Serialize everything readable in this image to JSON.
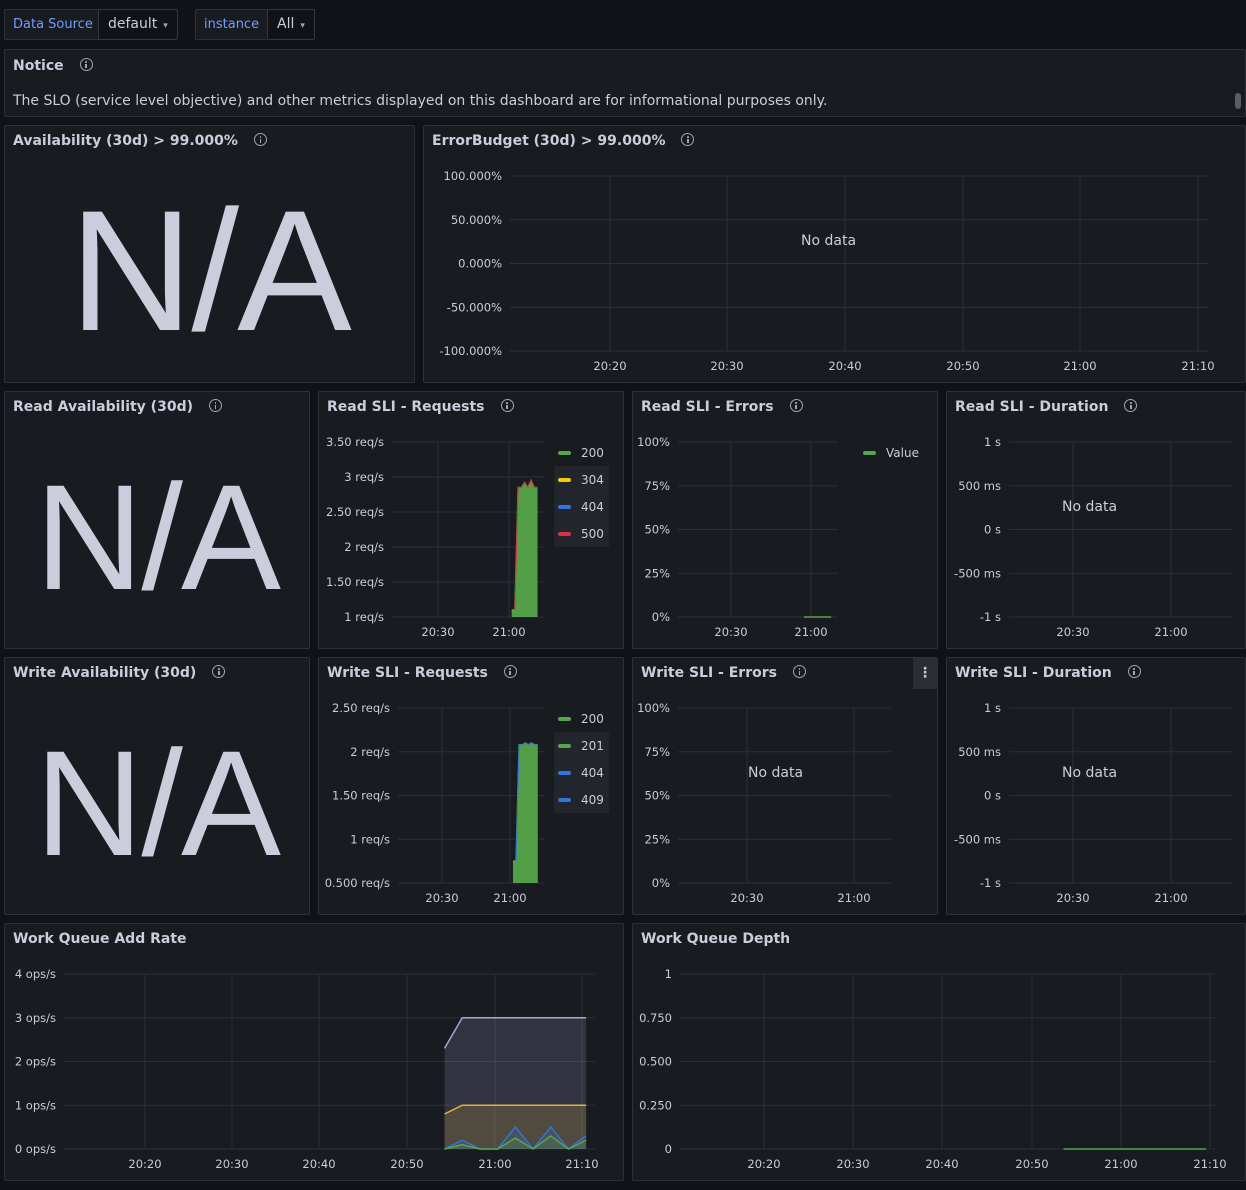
{
  "variables": {
    "datasource_label": "Data Source",
    "datasource_value": "default",
    "instance_label": "instance",
    "instance_value": "All"
  },
  "notice": {
    "title": "Notice",
    "text": "The SLO (service level objective) and other metrics displayed on this dashboard are for informational purposes only."
  },
  "panels": {
    "availability": {
      "title": "Availability (30d) > 99.000%",
      "value": "N/A"
    },
    "error_budget": {
      "title": "ErrorBudget (30d) > 99.000%",
      "no_data": "No data"
    },
    "read_availability": {
      "title": "Read Availability (30d)",
      "value": "N/A"
    },
    "read_requests": {
      "title": "Read SLI - Requests"
    },
    "read_errors": {
      "title": "Read SLI - Errors"
    },
    "read_duration": {
      "title": "Read SLI - Duration",
      "no_data": "No data"
    },
    "write_availability": {
      "title": "Write Availability (30d)",
      "value": "N/A"
    },
    "write_requests": {
      "title": "Write SLI - Requests"
    },
    "write_errors": {
      "title": "Write SLI - Errors",
      "no_data": "No data",
      "menu": "⋮"
    },
    "write_duration": {
      "title": "Write SLI - Duration",
      "no_data": "No data"
    },
    "wq_add_rate": {
      "title": "Work Queue Add Rate"
    },
    "wq_depth": {
      "title": "Work Queue Depth"
    }
  },
  "colors": {
    "green": "#56a64b",
    "yellow": "#f2cc0c",
    "blue": "#3274d9",
    "red": "#e02f44",
    "lavender": "#a9a4d8",
    "orange": "#e0b43c"
  },
  "chart_data": [
    {
      "id": "error_budget",
      "type": "line",
      "yticks": [
        "100.000%",
        "50.000%",
        "0.000%",
        "-50.000%",
        "-100.000%"
      ],
      "xticks": [
        "20:20",
        "20:30",
        "20:40",
        "20:50",
        "21:00",
        "21:10"
      ],
      "series": []
    },
    {
      "id": "read_requests",
      "type": "area",
      "yticks": [
        "3.50 req/s",
        "3 req/s",
        "2.50 req/s",
        "2 req/s",
        "1.50 req/s",
        "1 req/s"
      ],
      "ylim": [
        1,
        3.5
      ],
      "xticks": [
        "20:30",
        "21:00"
      ],
      "legend": [
        {
          "name": "200",
          "color": "#56a64b"
        },
        {
          "name": "304",
          "color": "#f2cc0c"
        },
        {
          "name": "404",
          "color": "#3274d9"
        },
        {
          "name": "500",
          "color": "#e02f44"
        }
      ],
      "series": [
        {
          "name": "200",
          "x": [
            "20:57",
            "20:58",
            "20:59",
            "21:00",
            "21:01",
            "21:02",
            "21:03",
            "21:04",
            "21:05"
          ],
          "values": [
            1.1,
            1.1,
            2.85,
            2.85,
            2.92,
            2.85,
            2.95,
            2.85,
            2.85
          ]
        }
      ]
    },
    {
      "id": "read_errors",
      "type": "line",
      "yticks": [
        "100%",
        "75%",
        "50%",
        "25%",
        "0%"
      ],
      "ylim": [
        0,
        100
      ],
      "xticks": [
        "20:30",
        "21:00"
      ],
      "legend": [
        {
          "name": "Value",
          "color": "#56a64b"
        }
      ],
      "series": [
        {
          "name": "Value",
          "x": [
            "20:57",
            "21:05"
          ],
          "values": [
            0,
            0
          ]
        }
      ]
    },
    {
      "id": "read_duration",
      "type": "line",
      "yticks": [
        "1 s",
        "500 ms",
        "0 s",
        "-500 ms",
        "-1 s"
      ],
      "xticks": [
        "20:30",
        "21:00"
      ],
      "series": []
    },
    {
      "id": "write_requests",
      "type": "area",
      "yticks": [
        "2.50 req/s",
        "2 req/s",
        "1.50 req/s",
        "1 req/s",
        "0.500 req/s"
      ],
      "ylim": [
        0.5,
        2.5
      ],
      "xticks": [
        "20:30",
        "21:00"
      ],
      "legend": [
        {
          "name": "200",
          "color": "#56a64b"
        },
        {
          "name": "201",
          "color": "#56a64b"
        },
        {
          "name": "404",
          "color": "#3274d9"
        },
        {
          "name": "409",
          "color": "#3274d9"
        }
      ],
      "series": [
        {
          "name": "201",
          "x": [
            "20:57",
            "20:58",
            "20:59",
            "21:00",
            "21:01",
            "21:02",
            "21:03",
            "21:04",
            "21:05"
          ],
          "values": [
            0.75,
            0.75,
            2.08,
            2.08,
            2.1,
            2.08,
            2.1,
            2.08,
            2.08
          ]
        }
      ]
    },
    {
      "id": "write_errors",
      "type": "line",
      "yticks": [
        "100%",
        "75%",
        "50%",
        "25%",
        "0%"
      ],
      "xticks": [
        "20:30",
        "21:00"
      ],
      "series": []
    },
    {
      "id": "write_duration",
      "type": "line",
      "yticks": [
        "1 s",
        "500 ms",
        "0 s",
        "-500 ms",
        "-1 s"
      ],
      "xticks": [
        "20:30",
        "21:00"
      ],
      "series": []
    },
    {
      "id": "wq_add_rate",
      "type": "area",
      "yticks": [
        "4 ops/s",
        "3 ops/s",
        "2 ops/s",
        "1 ops/s",
        "0 ops/s"
      ],
      "ylim": [
        0,
        4
      ],
      "xticks": [
        "20:20",
        "20:30",
        "20:40",
        "20:50",
        "21:00",
        "21:10"
      ],
      "series": [
        {
          "x": [
            "20:54",
            "20:56",
            "21:00",
            "21:05",
            "21:10"
          ],
          "values": [
            2.3,
            3.0,
            3.0,
            3.0,
            3.0
          ],
          "color": "#a9a4d8"
        },
        {
          "x": [
            "20:54",
            "20:56",
            "21:00",
            "21:05",
            "21:10"
          ],
          "values": [
            0.8,
            1.0,
            1.0,
            1.0,
            1.0
          ],
          "color": "#e0b43c"
        },
        {
          "x": [
            "20:54",
            "20:56",
            "20:58",
            "21:00",
            "21:02",
            "21:04",
            "21:06",
            "21:08",
            "21:10"
          ],
          "values": [
            0,
            0.2,
            0,
            0,
            0.5,
            0,
            0.5,
            0,
            0.3
          ],
          "color": "#3274d9"
        },
        {
          "x": [
            "20:54",
            "20:56",
            "20:58",
            "21:00",
            "21:02",
            "21:04",
            "21:06",
            "21:08",
            "21:10"
          ],
          "values": [
            0,
            0.1,
            0,
            0,
            0.25,
            0,
            0.3,
            0,
            0.2
          ],
          "color": "#56a64b"
        }
      ]
    },
    {
      "id": "wq_depth",
      "type": "line",
      "yticks": [
        "1",
        "0.750",
        "0.500",
        "0.250",
        "0"
      ],
      "ylim": [
        0,
        1
      ],
      "xticks": [
        "20:20",
        "20:30",
        "20:40",
        "20:50",
        "21:00",
        "21:10"
      ],
      "series": [
        {
          "x": [
            "20:54",
            "21:10"
          ],
          "values": [
            0,
            0
          ],
          "color": "#56a64b"
        }
      ]
    }
  ]
}
